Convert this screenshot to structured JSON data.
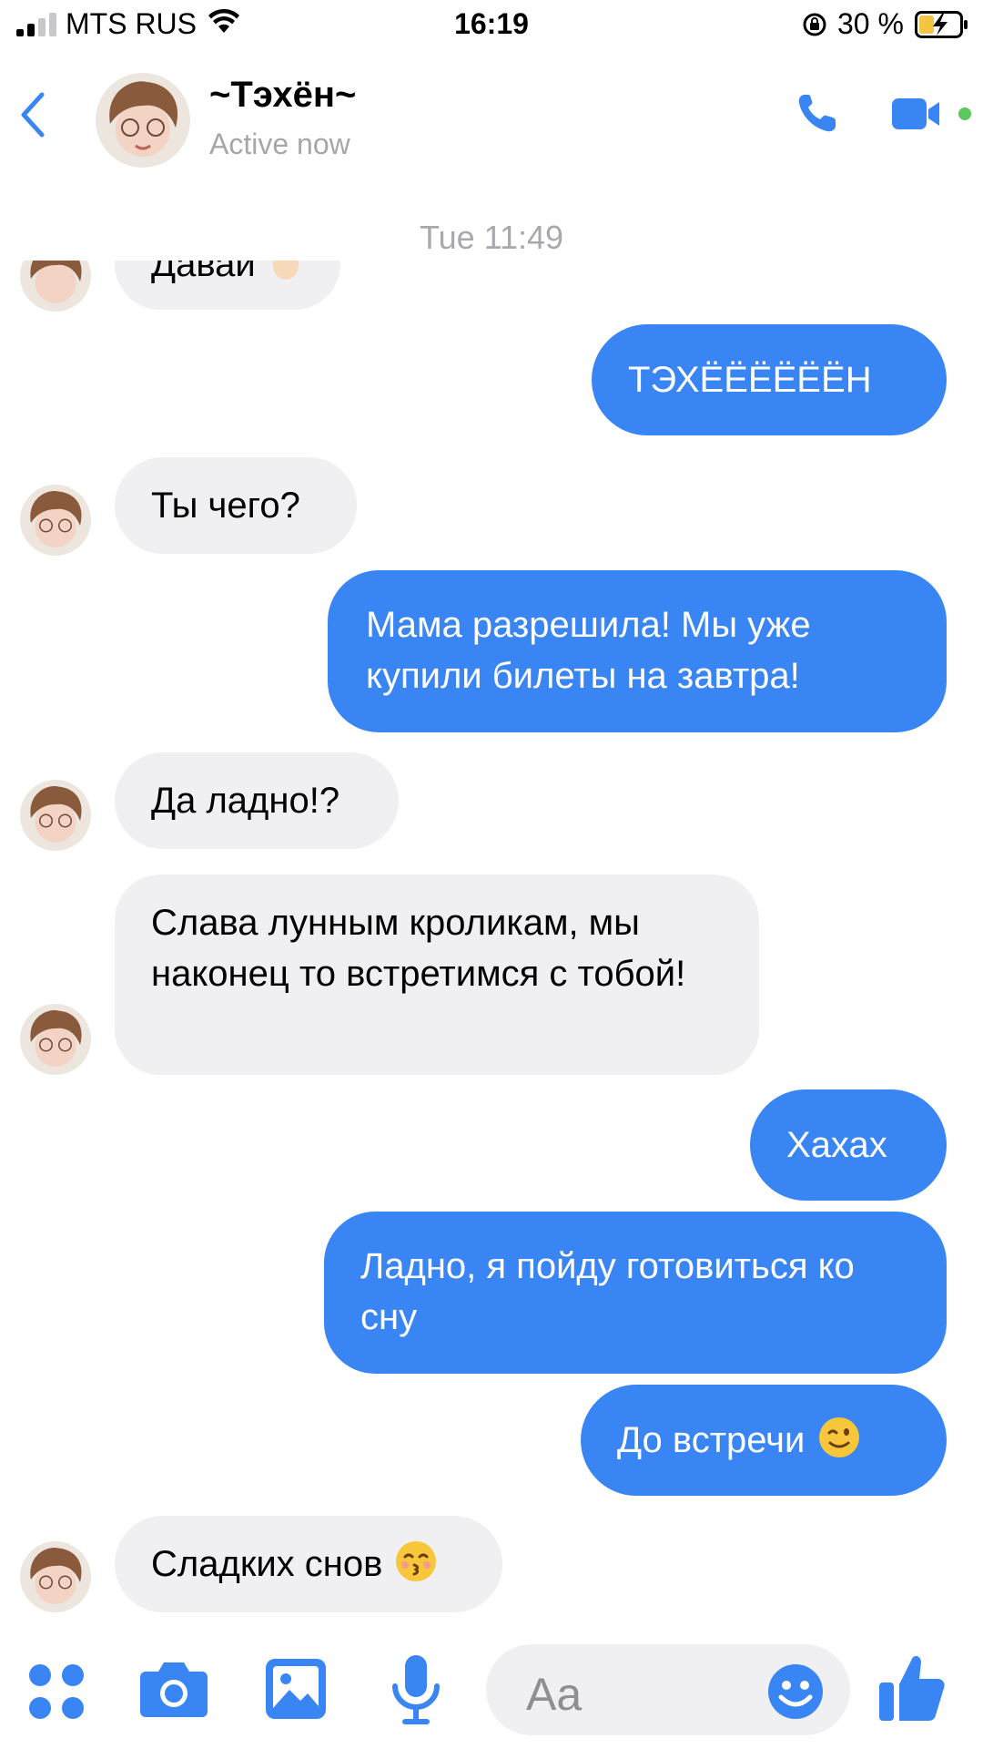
{
  "status_bar": {
    "carrier": "MTS RUS",
    "time": "16:19",
    "battery_percent": "30 %"
  },
  "header": {
    "name": "~Тэхён~",
    "status": "Active now",
    "accent_color": "#3a85f4",
    "online_dot_color": "#5ac85a"
  },
  "chat": {
    "date_separator": "Tue 11:49",
    "messages": [
      {
        "from": "them",
        "text": "Давай"
      },
      {
        "from": "me",
        "text": "ТЭХЁЁЁЁЁЁН"
      },
      {
        "from": "them",
        "text": "Ты чего?"
      },
      {
        "from": "me",
        "text": "Мама разрешила! Мы уже купили билеты на завтра!"
      },
      {
        "from": "them",
        "text": "Да ладно!?"
      },
      {
        "from": "them",
        "text": "Слава лунным кроликам, мы наконец то встретимся с тобой!"
      },
      {
        "from": "me",
        "text": "Хахах"
      },
      {
        "from": "me",
        "text": "Ладно, я пойду готовиться ко сну"
      },
      {
        "from": "me",
        "text": "До встречи",
        "emoji": "wink-emoji"
      },
      {
        "from": "them",
        "text": "Сладких снов",
        "emoji": "kiss-emoji"
      }
    ]
  },
  "composer": {
    "placeholder": "Aa",
    "icons": [
      "apps-icon",
      "camera-icon",
      "gallery-icon",
      "microphone-icon",
      "emoji-icon",
      "thumbs-up-icon"
    ]
  }
}
